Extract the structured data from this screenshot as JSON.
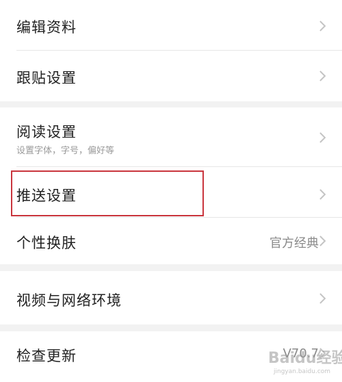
{
  "settings": {
    "edit_profile": "编辑资料",
    "follow_post": "跟贴设置",
    "reading": "阅读设置",
    "reading_sub": "设置字体，字号，偏好等",
    "push": "推送设置",
    "skin": "个性换肤",
    "skin_value": "官方经典",
    "video_network": "视频与网络环境",
    "check_update": "检查更新",
    "version": "V70.7"
  },
  "watermark": {
    "text": "Baidu经验",
    "url": "jingyan.baidu.com"
  },
  "colors": {
    "highlight_border": "#c9343c",
    "background": "#f2f2f2"
  },
  "icons": {
    "chevron": "chevron-right-icon"
  }
}
